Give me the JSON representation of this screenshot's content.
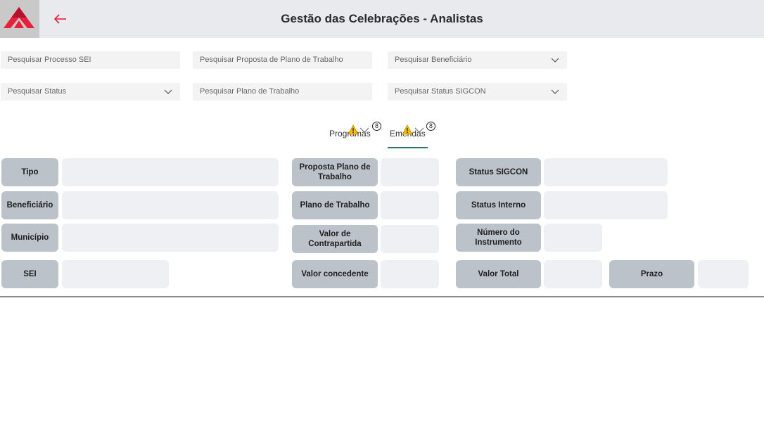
{
  "header": {
    "title": "Gestão das Celebrações - Analistas",
    "logo_icon": "red-triangle-logo",
    "back_icon": "arrow-left-icon",
    "accent_color": "#e8203a"
  },
  "search": {
    "processo_sei": "Pesquisar Processo SEI",
    "proposta_plano": "Pesquisar Proposta de Plano de Trabalho",
    "beneficiario": "Pesquisar Beneficiário",
    "status": "Pesquisar Status",
    "plano_trabalho": "Pesquisar Plano de Trabalho",
    "status_sigcon": "Pesquisar Status SIGCON"
  },
  "tabs": [
    {
      "label": "Programas",
      "badge": "8",
      "selected": false
    },
    {
      "label": "Emendas",
      "badge": "8",
      "selected": true
    }
  ],
  "details": {
    "tipo": {
      "label": "Tipo",
      "value": ""
    },
    "beneficiario": {
      "label": "Beneficiário",
      "value": ""
    },
    "municipio": {
      "label": "Município",
      "value": ""
    },
    "sei": {
      "label": "SEI",
      "value": ""
    },
    "proposta_plano": {
      "label": "Proposta Plano de Trabalho",
      "value": ""
    },
    "plano_trabalho": {
      "label": "Plano de Trabalho",
      "value": ""
    },
    "valor_contrapartida": {
      "label": "Valor de Contrapartida",
      "value": ""
    },
    "valor_concedente": {
      "label": "Valor concedente",
      "value": ""
    },
    "status_sigcon": {
      "label": "Status SIGCON",
      "value": ""
    },
    "status_interno": {
      "label": "Status Interno",
      "value": ""
    },
    "numero_instrumento": {
      "label": "Número do Instrumento",
      "value": ""
    },
    "valor_total": {
      "label": "Valor Total",
      "value": ""
    },
    "prazo": {
      "label": "Prazo",
      "value": ""
    }
  }
}
